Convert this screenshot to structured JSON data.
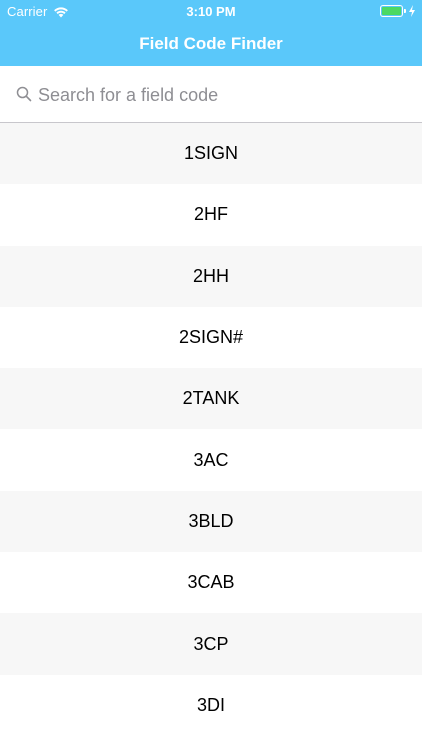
{
  "status_bar": {
    "carrier": "Carrier",
    "time": "3:10 PM",
    "wifi_icon": "wifi-icon",
    "battery_icon": "battery-icon",
    "charging_icon": "charging-icon"
  },
  "nav": {
    "title": "Field Code Finder"
  },
  "search": {
    "placeholder": "Search for a field code",
    "value": "",
    "icon": "search-icon"
  },
  "list": {
    "items": [
      "1SIGN",
      "2HF",
      "2HH",
      "2SIGN#",
      "2TANK",
      "3AC",
      "3BLD",
      "3CAB",
      "3CP",
      "3DI"
    ]
  },
  "colors": {
    "header_bg": "#5ac8fa",
    "row_alt_bg": "#f7f7f7",
    "battery_fill": "#4cd964"
  }
}
